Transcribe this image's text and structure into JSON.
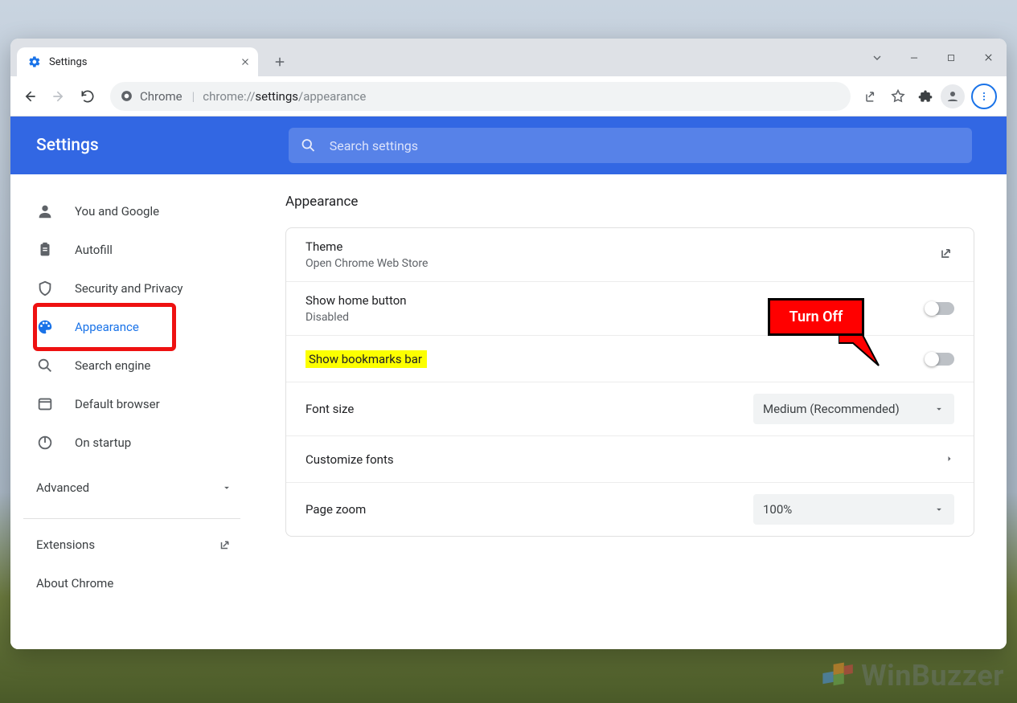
{
  "tab": {
    "title": "Settings"
  },
  "omnibox": {
    "secure_label": "Chrome",
    "url_prefix": "chrome://",
    "url_mid": "settings",
    "url_suffix": "/appearance"
  },
  "header": {
    "title": "Settings",
    "search_placeholder": "Search settings"
  },
  "sidebar": {
    "items": [
      {
        "label": "You and Google"
      },
      {
        "label": "Autofill"
      },
      {
        "label": "Security and Privacy"
      },
      {
        "label": "Appearance"
      },
      {
        "label": "Search engine"
      },
      {
        "label": "Default browser"
      },
      {
        "label": "On startup"
      }
    ],
    "advanced": "Advanced",
    "extensions": "Extensions",
    "about": "About Chrome"
  },
  "section_title": "Appearance",
  "rows": {
    "theme": {
      "title": "Theme",
      "sub": "Open Chrome Web Store"
    },
    "home": {
      "title": "Show home button",
      "sub": "Disabled"
    },
    "bookmarks": {
      "title": "Show bookmarks bar"
    },
    "fontsize": {
      "title": "Font size",
      "value": "Medium (Recommended)"
    },
    "customfonts": {
      "title": "Customize fonts"
    },
    "zoom": {
      "title": "Page zoom",
      "value": "100%"
    }
  },
  "callout": {
    "text": "Turn Off"
  },
  "watermark": "WinBuzzer"
}
